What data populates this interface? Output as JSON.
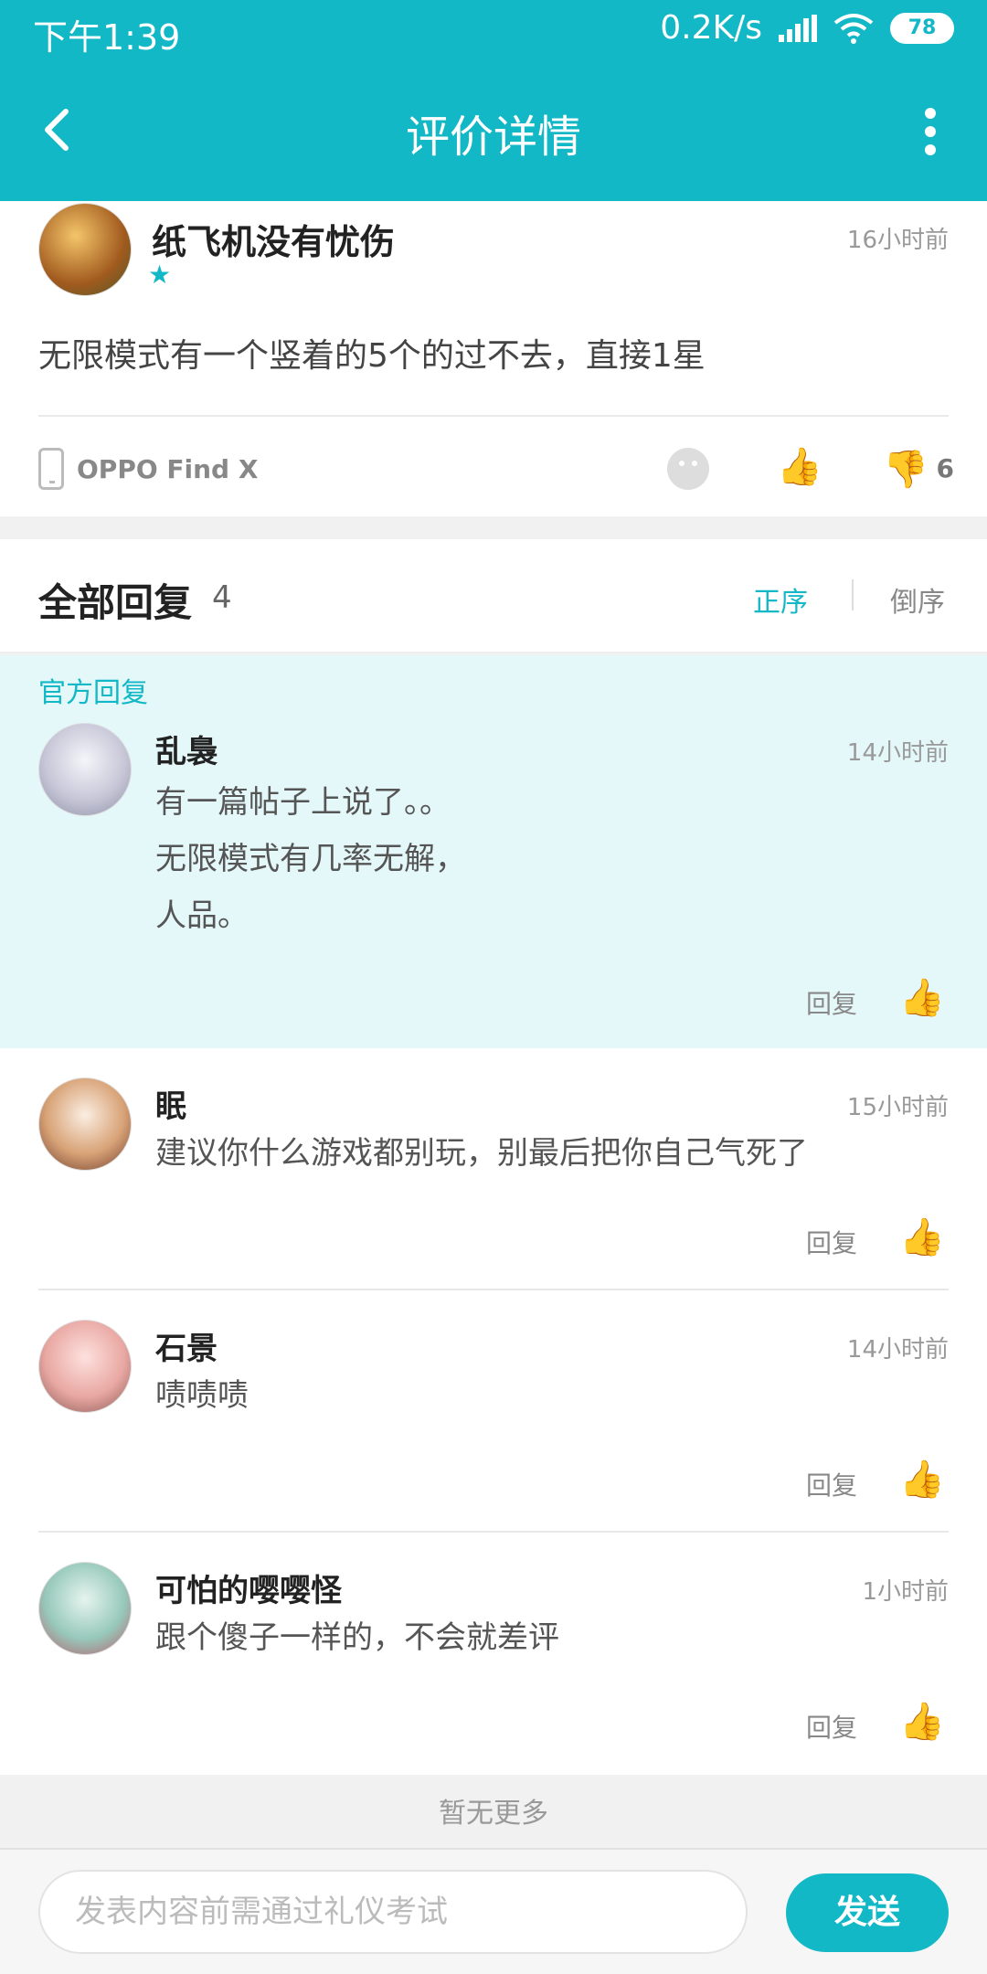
{
  "status_bar": {
    "time": "下午1:39",
    "speed": "0.2K/s",
    "battery": "78"
  },
  "nav": {
    "title": "评价详情",
    "back_icon": "back-icon",
    "more_icon": "more-icon"
  },
  "review": {
    "author": "纸飞机没有忧伤",
    "time": "16小时前",
    "stars": "★",
    "content": "无限模式有一个竖着的5个的过不去，直接1星",
    "device": "OPPO Find X",
    "dislike_count": "6"
  },
  "replies_header": {
    "title": "全部回复",
    "count": "4",
    "sort_asc": "正序",
    "sort_desc": "倒序"
  },
  "replies": [
    {
      "tag": "官方回复",
      "author": "乱裊",
      "time": "14小时前",
      "lines": [
        "有一篇帖子上说了。。",
        "无限模式有几率无解，",
        "人品。"
      ],
      "reply_label": "回复"
    },
    {
      "author": "眠",
      "time": "15小时前",
      "lines": [
        "建议你什么游戏都别玩，别最后把你自己气死了"
      ],
      "reply_label": "回复"
    },
    {
      "author": "石景",
      "time": "14小时前",
      "lines": [
        "啧啧啧"
      ],
      "reply_label": "回复"
    },
    {
      "author": "可怕的嘤嘤怪",
      "time": "1小时前",
      "lines": [
        "跟个傻子一样的，不会就差评"
      ],
      "reply_label": "回复"
    }
  ],
  "footer": {
    "no_more": "暂无更多",
    "input_placeholder": "发表内容前需通过礼仪考试",
    "send_label": "发送"
  },
  "colors": {
    "accent": "#13b8c6",
    "official_bg": "#e4f7f9"
  }
}
